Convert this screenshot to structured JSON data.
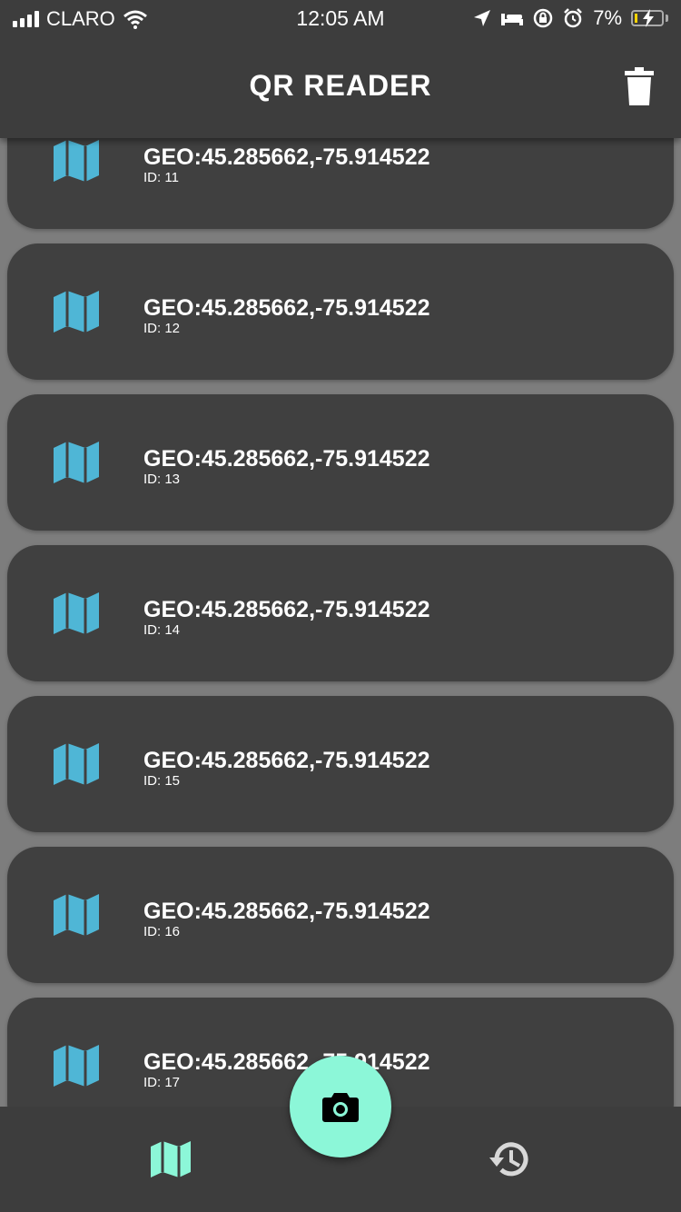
{
  "status_bar": {
    "carrier": "CLARO",
    "time": "12:05 AM",
    "battery_percent": "7%",
    "icons": [
      "signal-icon",
      "wifi-icon",
      "location-arrow-icon",
      "bed-icon",
      "rotation-lock-icon",
      "alarm-icon",
      "battery-charging-icon"
    ]
  },
  "app_bar": {
    "title": "QR READER",
    "action_icon": "trash-icon"
  },
  "list": {
    "items": [
      {
        "value": "GEO:45.285662,-75.914522",
        "id_label": "ID: 11",
        "icon": "map-icon"
      },
      {
        "value": "GEO:45.285662,-75.914522",
        "id_label": "ID: 12",
        "icon": "map-icon"
      },
      {
        "value": "GEO:45.285662,-75.914522",
        "id_label": "ID: 13",
        "icon": "map-icon"
      },
      {
        "value": "GEO:45.285662,-75.914522",
        "id_label": "ID: 14",
        "icon": "map-icon"
      },
      {
        "value": "GEO:45.285662,-75.914522",
        "id_label": "ID: 15",
        "icon": "map-icon"
      },
      {
        "value": "GEO:45.285662,-75.914522",
        "id_label": "ID: 16",
        "icon": "map-icon"
      },
      {
        "value": "GEO:45.285662,-75.914522",
        "id_label": "ID: 17",
        "icon": "map-icon"
      }
    ]
  },
  "bottom_nav": {
    "items": [
      {
        "icon": "map-icon",
        "active": true
      },
      {
        "icon": "history-icon",
        "active": false
      }
    ]
  },
  "fab": {
    "icon": "camera-icon"
  },
  "colors": {
    "surface": "#3d3d3d",
    "card": "#404040",
    "background": "#7d7d7d",
    "map_icon": "#4fb6d6",
    "accent": "#8cf7d8",
    "text": "#ffffff"
  }
}
